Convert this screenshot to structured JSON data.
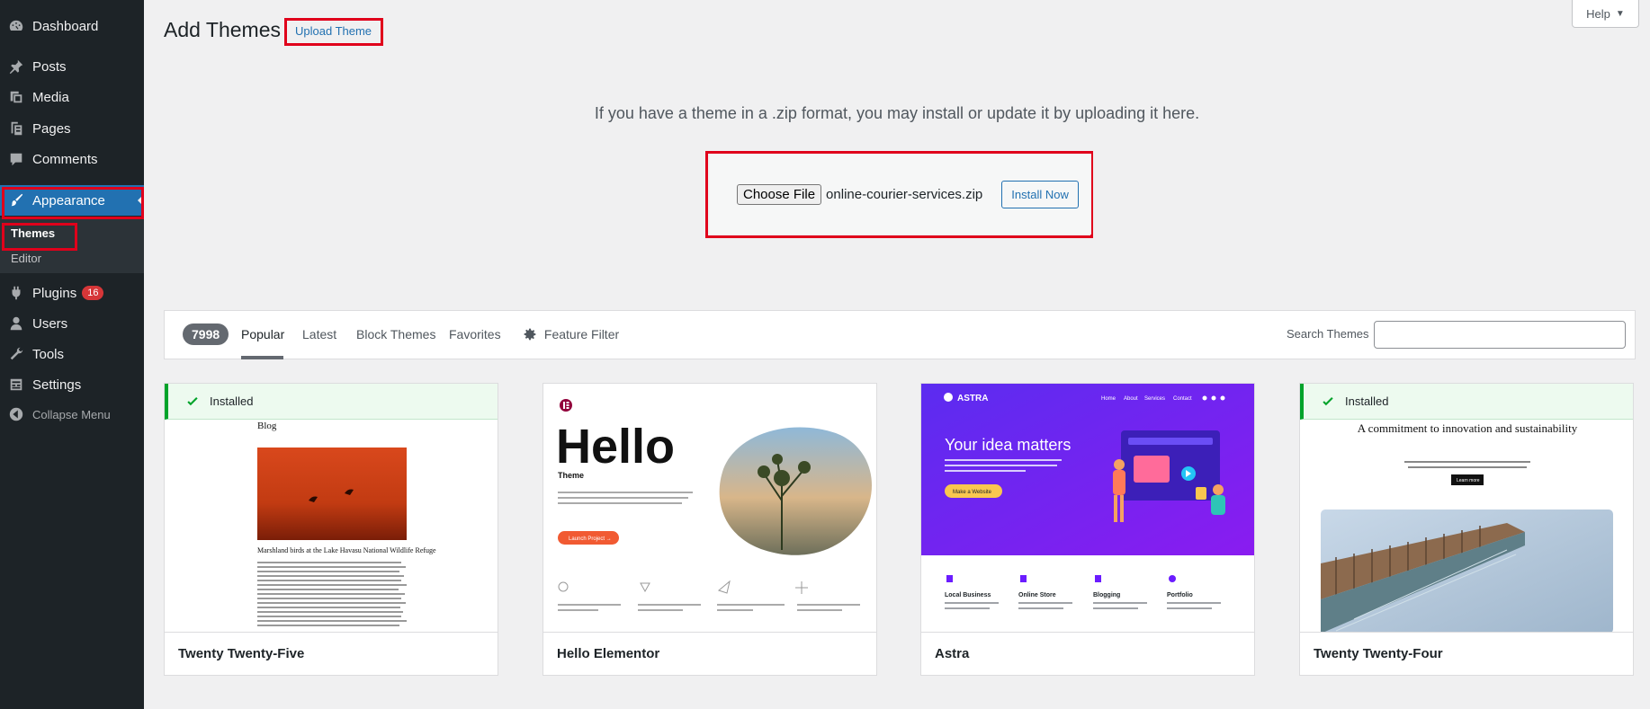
{
  "sidebar": {
    "items": [
      {
        "label": "Dashboard",
        "icon": "dashboard-icon"
      },
      {
        "label": "Posts",
        "icon": "pin-icon"
      },
      {
        "label": "Media",
        "icon": "media-icon"
      },
      {
        "label": "Pages",
        "icon": "pages-icon"
      },
      {
        "label": "Comments",
        "icon": "comment-icon"
      },
      {
        "label": "Appearance",
        "icon": "brush-icon"
      },
      {
        "label": "Plugins",
        "icon": "plugin-icon",
        "badge": "16"
      },
      {
        "label": "Users",
        "icon": "user-icon"
      },
      {
        "label": "Tools",
        "icon": "wrench-icon"
      },
      {
        "label": "Settings",
        "icon": "settings-icon"
      }
    ],
    "submenu": [
      "Themes",
      "Editor"
    ],
    "collapse_label": "Collapse Menu"
  },
  "header": {
    "help_label": "Help",
    "title": "Add Themes",
    "upload_link": "Upload Theme"
  },
  "upload": {
    "instructions": "If you have a theme in a .zip format, you may install or update it by uploading it here.",
    "choose_label": "Choose File",
    "file_name": "online-courier-services.zip",
    "install_label": "Install Now"
  },
  "filter": {
    "count": "7998",
    "tabs": [
      "Popular",
      "Latest",
      "Block Themes",
      "Favorites"
    ],
    "feature_filter": "Feature Filter",
    "search_label": "Search Themes",
    "search_value": ""
  },
  "themes": [
    {
      "name": "Twenty Twenty-Five",
      "installed": "Installed",
      "preview_title": "Blog",
      "preview_caption": "Marshland birds at the Lake Havasu National Wildlife Refuge"
    },
    {
      "name": "Hello Elementor",
      "preview_title": "Hello",
      "preview_subtitle": "Theme",
      "preview_button": "Launch Project →"
    },
    {
      "name": "Astra",
      "preview_brand": "ASTRA",
      "preview_headline": "Your idea matters",
      "preview_button": "Make a Website",
      "preview_nav": [
        "Home",
        "About",
        "Services",
        "Contact"
      ],
      "preview_features": [
        "Local Business",
        "Online Store",
        "Blogging",
        "Portfolio"
      ]
    },
    {
      "name": "Twenty Twenty-Four",
      "installed": "Installed",
      "preview_title": "A commitment to innovation and sustainability",
      "preview_button": "Learn more"
    }
  ],
  "colors": {
    "sidebar_bg": "#1d2327",
    "accent": "#2271b1",
    "highlight_box": "#e0001b",
    "installed_green": "#00a32a",
    "astra_purple": "#6b1cff"
  }
}
